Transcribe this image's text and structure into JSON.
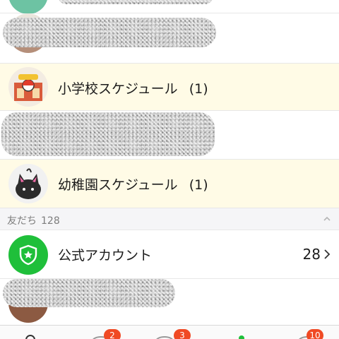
{
  "friend_list": {
    "groups": [
      {
        "name": "小学校スケジュール",
        "count": "(1)"
      },
      {
        "name": "幼稚園スケジュール",
        "count": "(1)"
      }
    ],
    "friends_section": {
      "title": "友だち",
      "count": "128"
    },
    "official_accounts": {
      "label": "公式アカウント",
      "count": "28"
    }
  },
  "tabbar": {
    "badges": [
      "2",
      "3",
      "10"
    ]
  },
  "colors": {
    "highlight_row": "#fffbe6",
    "official_green": "#1fbf3a",
    "badge_red": "#f04a24",
    "section_bg": "#f5f5f7"
  },
  "icons": {
    "collapse": "chevron-up-icon",
    "official": "shield-star-icon",
    "official_open": "chevron-right-icon"
  }
}
